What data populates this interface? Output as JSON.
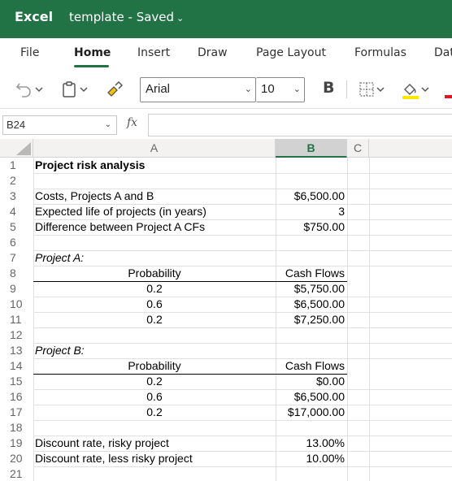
{
  "titlebar": {
    "app_name": "Excel",
    "doc_name": "template",
    "separator": "-",
    "status": "Saved"
  },
  "tabs": [
    {
      "label": "File"
    },
    {
      "label": "Home"
    },
    {
      "label": "Insert"
    },
    {
      "label": "Draw"
    },
    {
      "label": "Page Layout"
    },
    {
      "label": "Formulas"
    },
    {
      "label": "Dat"
    }
  ],
  "toolbar": {
    "font_name": "Arial",
    "font_size": "10",
    "bold_label": "B"
  },
  "formula_bar": {
    "cell_ref": "B24",
    "fx_label": "fx",
    "formula": ""
  },
  "columns": [
    "A",
    "B",
    "C"
  ],
  "rows": [
    "1",
    "2",
    "3",
    "4",
    "5",
    "6",
    "7",
    "8",
    "9",
    "10",
    "11",
    "12",
    "13",
    "14",
    "15",
    "16",
    "17",
    "18",
    "19",
    "20",
    "21"
  ],
  "sheet": {
    "r1": {
      "a": "Project risk analysis",
      "b": ""
    },
    "r3": {
      "a": "Costs, Projects A and B",
      "b": "$6,500.00"
    },
    "r4": {
      "a": "Expected life of projects (in years)",
      "b": "3"
    },
    "r5": {
      "a": "Difference between Project A CFs",
      "b": "$750.00"
    },
    "r7": {
      "a": "Project A:",
      "b": ""
    },
    "r8": {
      "a": "Probability",
      "b": "Cash Flows"
    },
    "r9": {
      "a": "0.2",
      "b": "$5,750.00"
    },
    "r10": {
      "a": "0.6",
      "b": "$6,500.00"
    },
    "r11": {
      "a": "0.2",
      "b": "$7,250.00"
    },
    "r13": {
      "a": "Project B:",
      "b": ""
    },
    "r14": {
      "a": "Probability",
      "b": "Cash Flows"
    },
    "r15": {
      "a": "0.2",
      "b": "$0.00"
    },
    "r16": {
      "a": "0.6",
      "b": "$6,500.00"
    },
    "r17": {
      "a": "0.2",
      "b": "$17,000.00"
    },
    "r19": {
      "a": "Discount rate, risky project",
      "b": "13.00%"
    },
    "r20": {
      "a": "Discount rate, less risky project",
      "b": "10.00%"
    }
  },
  "colors": {
    "brand": "#217346",
    "header_bg": "#f3f2f1",
    "selected_header": "#d2d2d2"
  }
}
